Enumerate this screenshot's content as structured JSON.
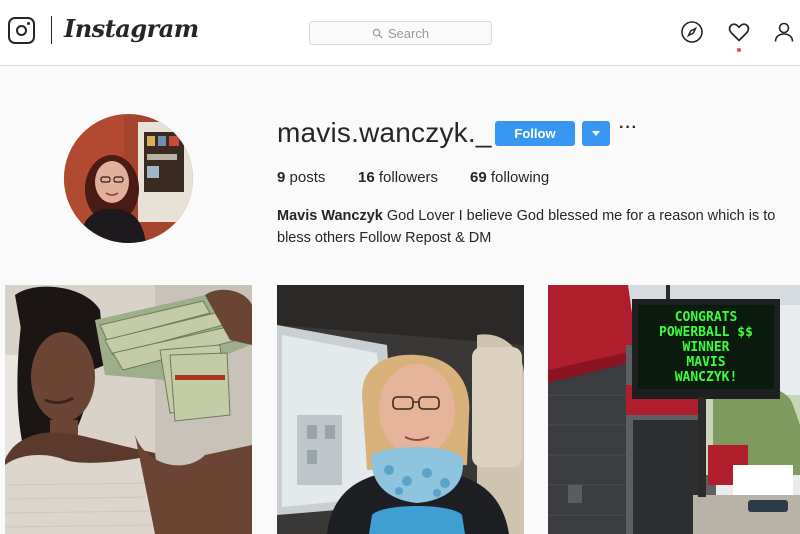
{
  "header": {
    "brand": "Instagram",
    "search_placeholder": "Search"
  },
  "profile": {
    "username": "mavis.wanczyk._",
    "follow_label": "Follow",
    "stats": {
      "posts_count": "9",
      "posts_label": "posts",
      "followers_count": "16",
      "followers_label": "followers",
      "following_count": "69",
      "following_label": "following"
    },
    "full_name": "Mavis Wanczyk",
    "bio": "God Lover I believe God blessed me for a reason which is to bless others Follow Repost & DM"
  },
  "posts": [
    {
      "icon": "photo"
    },
    {
      "icon": "photo"
    },
    {
      "icon": "photo",
      "sign_lines": [
        "CONGRATS",
        "POWERBALL $$",
        "WINNER",
        "MAVIS",
        "WANCZYK!"
      ]
    }
  ],
  "colors": {
    "accent": "#3897f0",
    "notification": "#ed4956",
    "sign_text": "#3cff3c",
    "awning": "#b01d2c"
  }
}
